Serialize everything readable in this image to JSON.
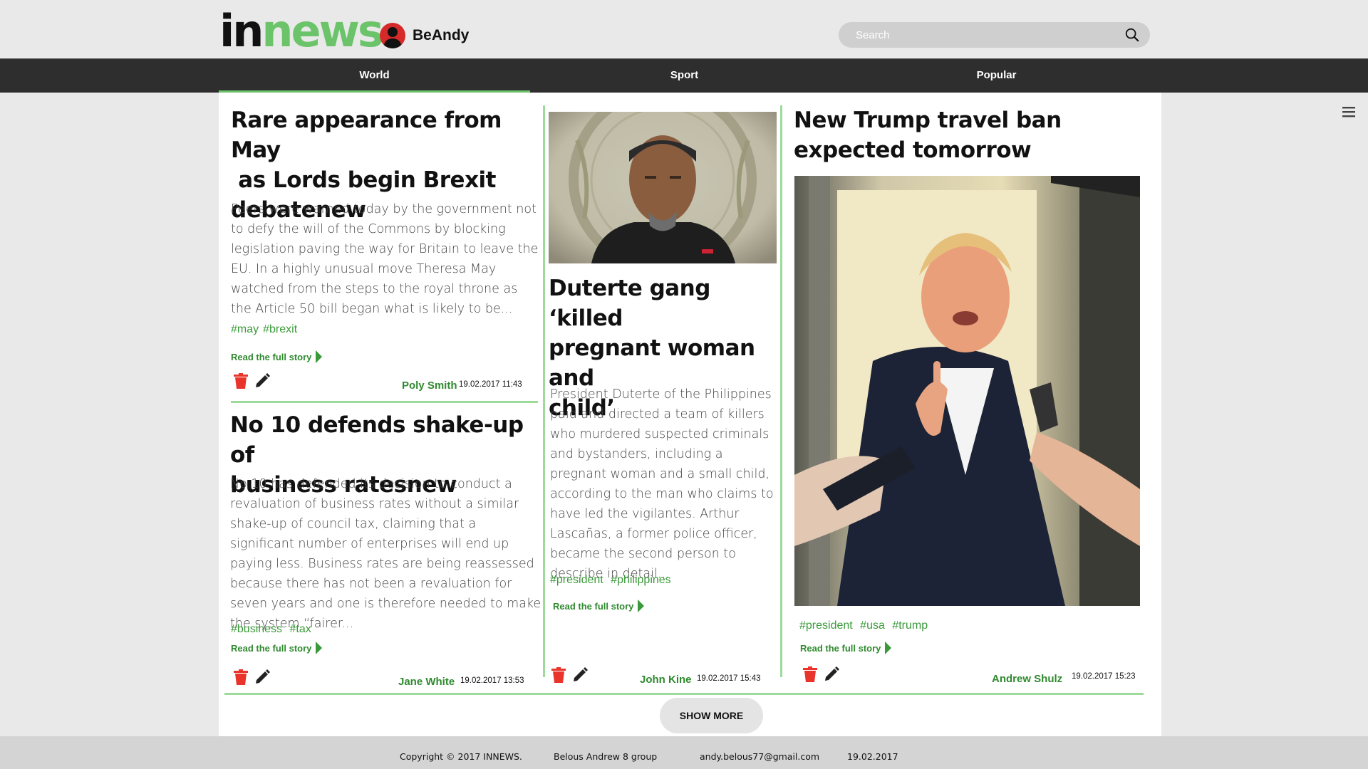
{
  "header": {
    "logo_part1": "in",
    "logo_part2": "news",
    "username": "BeAndy",
    "search_placeholder": "Search"
  },
  "nav": {
    "tabs": [
      {
        "label": "World",
        "active": true
      },
      {
        "label": "Sport",
        "active": false
      },
      {
        "label": "Popular",
        "active": false
      }
    ]
  },
  "colors": {
    "accent": "#6cc46a",
    "nav_bg": "#2e2e2e",
    "tag_green": "#3a9a3a",
    "delete_red": "#e8342a"
  },
  "articles": [
    {
      "title": "Rare appearance from May  as Lords begin Brexit debatenew",
      "title_lines": [
        "Rare appearance from May",
        " as Lords begin Brexit",
        "debatenew"
      ],
      "description": "Peers were warned today by the government not to defy the will of the Commons by blocking legislation paving the way for Britain to leave the EU. In a highly unusual move Theresa May watched from the steps to the royal throne as the Article 50 bill began what is likely to be...",
      "tags": [
        "#may",
        "#brexit"
      ],
      "read_more": "Read the full story",
      "author": "Poly Smith",
      "date": "19.02.2017 11:43"
    },
    {
      "title_lines": [
        "No 10 defends shake-up of",
        "business ratesnew"
      ],
      "description": "No 10 has defended its decision to conduct a revaluation of business rates without a similar shake-up of council tax, claiming that a significant number of enterprises will end up paying less. Business rates are being reassessed because there has not been a revaluation for seven years and one is therefore needed to make the system “fairer...",
      "tags": [
        "#business",
        "#tax"
      ],
      "read_more": "Read the full story",
      "author": "Jane White",
      "date": "19.02.2017 13:53"
    },
    {
      "title_lines": [
        "Duterte gang ‘killed",
        "pregnant woman and",
        "child’"
      ],
      "description": "President Duterte of the Philippines paid and directed a team of killers who murdered suspected criminals and bystanders, including a pregnant woman and a small child, according to the man who claims to have led the vigilantes. Arthur Lascañas, a former police officer, became the second person to describe in detail...",
      "tags": [
        "#president",
        "#philippines"
      ],
      "read_more": "Read the full story",
      "author": "John Kine",
      "date": "19.02.2017 15:43"
    },
    {
      "title_lines": [
        "New Trump travel ban",
        "expected tomorrow"
      ],
      "tags": [
        "#president",
        "#usa",
        "#trump"
      ],
      "read_more": "Read the full story",
      "author": "Andrew Shulz",
      "date": "19.02.2017 15:23"
    }
  ],
  "show_more": "SHOW MORE",
  "footer": {
    "copyright": "Copyright © 2017 INNEWS.",
    "group": "Belous Andrew 8 group",
    "email": "andy.belous77@gmail.com",
    "date": "19.02.2017"
  }
}
